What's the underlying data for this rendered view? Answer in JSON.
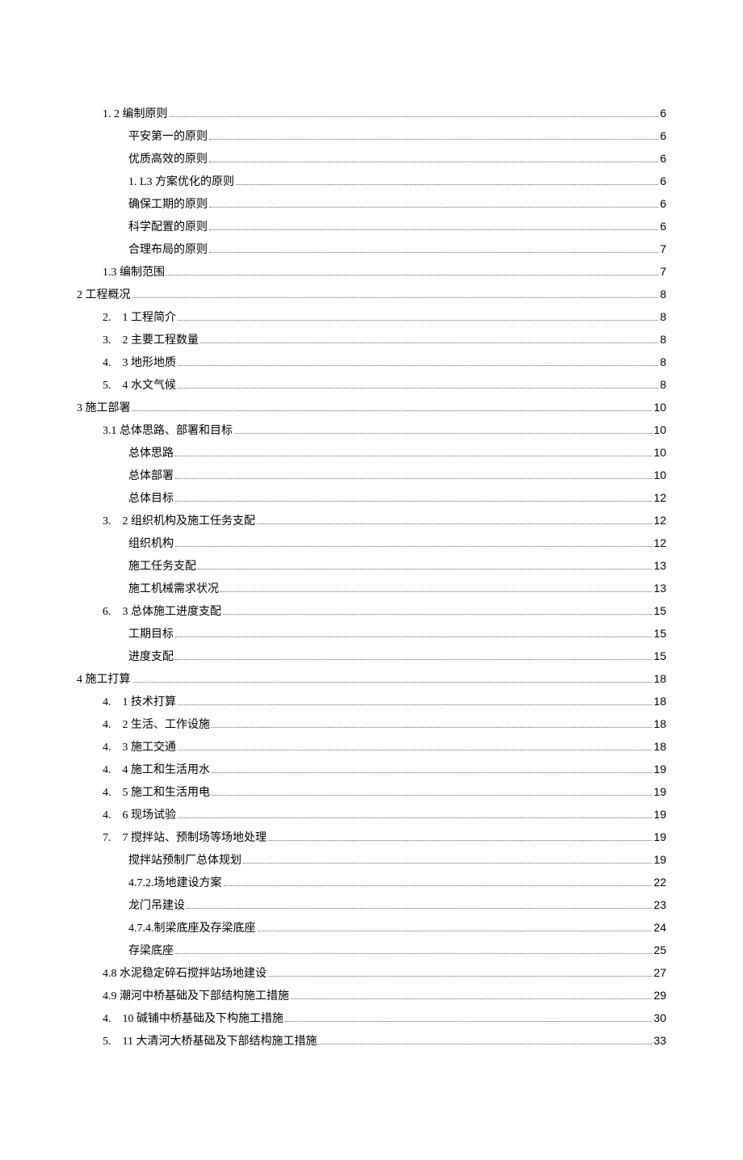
{
  "toc": [
    {
      "indent": 1,
      "prefix": "1. 2 ",
      "label": "编制原则",
      "page": "6"
    },
    {
      "indent": 2,
      "prefix": "",
      "label": "平安第一的原则",
      "page": "6"
    },
    {
      "indent": 2,
      "prefix": "",
      "label": "优质高效的原则",
      "page": "6"
    },
    {
      "indent": 2,
      "prefix": "1. L3 ",
      "label": "方案优化的原则",
      "page": "6"
    },
    {
      "indent": 2,
      "prefix": "",
      "label": "确保工期的原则",
      "page": "6"
    },
    {
      "indent": 2,
      "prefix": "",
      "label": "科学配置的原则",
      "page": "6"
    },
    {
      "indent": 2,
      "prefix": "",
      "label": "合理布局的原则",
      "page": "7"
    },
    {
      "indent": 1,
      "prefix": "1.3 ",
      "label": "编制范围",
      "page": "7"
    },
    {
      "indent": 0,
      "prefix": "2 ",
      "label": "工程概况",
      "page": "8"
    },
    {
      "indent": 1,
      "prefix": "2.　1 ",
      "label": "工程简介",
      "page": "8"
    },
    {
      "indent": 1,
      "prefix": "3.　2 ",
      "label": "主要工程数量",
      "page": "8"
    },
    {
      "indent": 1,
      "prefix": "4.　3 ",
      "label": "地形地质",
      "page": "8"
    },
    {
      "indent": 1,
      "prefix": "5.　4 ",
      "label": "水文气候",
      "page": "8"
    },
    {
      "indent": 0,
      "prefix": "3 ",
      "label": "施工部署",
      "page": "10"
    },
    {
      "indent": 1,
      "prefix": "3.1 ",
      "label": "总体思路、部署和目标",
      "page": "10"
    },
    {
      "indent": 2,
      "prefix": "",
      "label": "总体思路",
      "page": "10"
    },
    {
      "indent": 2,
      "prefix": "",
      "label": "总体部署",
      "page": "10"
    },
    {
      "indent": 2,
      "prefix": "",
      "label": "总体目标",
      "page": "12"
    },
    {
      "indent": 1,
      "prefix": "3.　2 ",
      "label": "组织机构及施工任务支配",
      "page": "12"
    },
    {
      "indent": 2,
      "prefix": "",
      "label": "组织机构",
      "page": "12"
    },
    {
      "indent": 2,
      "prefix": "",
      "label": "施工任务支配",
      "page": "13"
    },
    {
      "indent": 2,
      "prefix": "",
      "label": "施工机械需求状况",
      "page": "13"
    },
    {
      "indent": 1,
      "prefix": "6.　3 ",
      "label": "总体施工进度支配",
      "page": "15"
    },
    {
      "indent": 2,
      "prefix": "",
      "label": "工期目标",
      "page": "15"
    },
    {
      "indent": 2,
      "prefix": "",
      "label": "进度支配",
      "page": "15"
    },
    {
      "indent": 0,
      "prefix": "4 ",
      "label": "施工打算",
      "page": "18"
    },
    {
      "indent": 1,
      "prefix": "4.　1 ",
      "label": "技术打算",
      "page": "18"
    },
    {
      "indent": 1,
      "prefix": "4.　2 ",
      "label": "生活、工作设施",
      "page": "18"
    },
    {
      "indent": 1,
      "prefix": "4.　3 ",
      "label": "施工交通",
      "page": "18"
    },
    {
      "indent": 1,
      "prefix": "4.　4 ",
      "label": "施工和生活用水",
      "page": "19"
    },
    {
      "indent": 1,
      "prefix": "4.　5 ",
      "label": "施工和生活用电",
      "page": "19"
    },
    {
      "indent": 1,
      "prefix": "4.　6 ",
      "label": "现场试验",
      "page": "19"
    },
    {
      "indent": 1,
      "prefix": "7.　7 ",
      "label": "搅拌站、预制场等场地处理",
      "page": "19"
    },
    {
      "indent": 2,
      "prefix": "",
      "label": "搅拌站预制厂总体规划",
      "page": "19"
    },
    {
      "indent": 2,
      "prefix": "4.7.2.",
      "label": "场地建设方案",
      "page": "22"
    },
    {
      "indent": 2,
      "prefix": "",
      "label": "龙门吊建设",
      "page": "23"
    },
    {
      "indent": 2,
      "prefix": "4.7.4.",
      "label": "制梁底座及存梁底座",
      "page": "24"
    },
    {
      "indent": 2,
      "prefix": "",
      "label": "存梁底座",
      "page": "25"
    },
    {
      "indent": 1,
      "prefix": "4.8 ",
      "label": "水泥稳定碎石搅拌站场地建设",
      "page": "27"
    },
    {
      "indent": 1,
      "prefix": "4.9 ",
      "label": "潮河中桥基础及下部结构施工措施",
      "page": "29"
    },
    {
      "indent": 1,
      "prefix": "4.　10 ",
      "label": "碱铺中桥基础及下构施工措施",
      "page": "30"
    },
    {
      "indent": 1,
      "prefix": "5.　11 ",
      "label": "大清河大桥基础及下部结构施工措施",
      "page": "33"
    }
  ]
}
